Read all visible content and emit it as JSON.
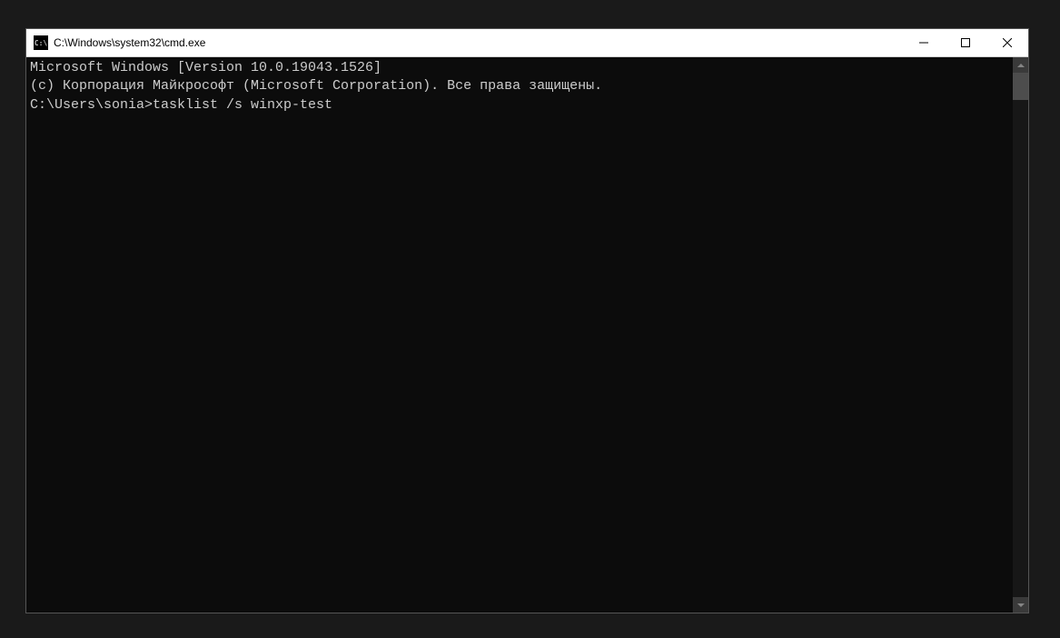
{
  "titlebar": {
    "icon_label": "C:\\",
    "title": "C:\\Windows\\system32\\cmd.exe"
  },
  "console": {
    "lines": [
      "Microsoft Windows [Version 10.0.19043.1526]",
      "(c) Корпорация Майкрософт (Microsoft Corporation). Все права защищены.",
      "",
      "C:\\Users\\sonia>tasklist /s winxp-test"
    ]
  }
}
